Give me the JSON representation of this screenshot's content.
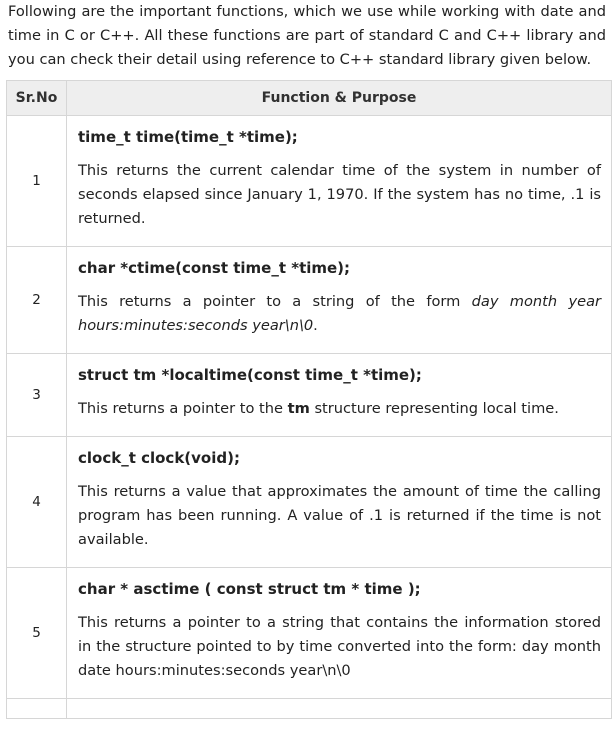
{
  "intro": "Following are the important functions, which we use while working with date and time in C or C++. All these functions are part of standard C and C++ library and you can check their detail using reference to C++ standard library given below.",
  "table": {
    "headers": [
      "Sr.No",
      "Function & Purpose"
    ],
    "rows": [
      {
        "num": "1",
        "signature": "time_t time(time_t *time);",
        "description": "This returns the current calendar time of the system in number of seconds elapsed since January 1, 1970. If the system has no time, .1 is returned."
      },
      {
        "num": "2",
        "signature": "char *ctime(const time_t *time);",
        "desc_prefix": "This returns a pointer to a string of the form ",
        "desc_italic": "day month year hours:minutes:seconds year\\n\\0",
        "desc_suffix": "."
      },
      {
        "num": "3",
        "signature": "struct tm *localtime(const time_t *time);",
        "desc_prefix": "This returns a pointer to the ",
        "desc_bold": "tm",
        "desc_suffix": " structure representing local time."
      },
      {
        "num": "4",
        "signature": "clock_t clock(void);",
        "description": "This returns a value that approximates the amount of time the calling program has been running. A value of .1 is returned if the time is not available."
      },
      {
        "num": "5",
        "signature": "char * asctime ( const struct tm * time );",
        "description": "This returns a pointer to a string that contains the information stored in the structure pointed to by time converted into the form: day month date hours:minutes:seconds year\\n\\0"
      }
    ]
  }
}
